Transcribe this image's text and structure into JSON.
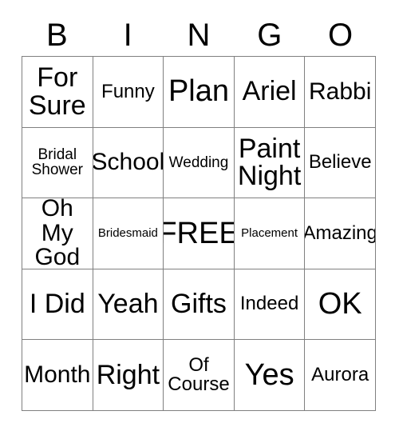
{
  "card": {
    "header_letters": [
      "B",
      "I",
      "N",
      "G",
      "O"
    ],
    "free_space_label": "FREE",
    "colors": {
      "grid_line": "#808080",
      "text": "#000000",
      "background": "#ffffff"
    },
    "rows": [
      [
        {
          "label": "For\nSure",
          "size": "xl"
        },
        {
          "label": "Funny",
          "size": "m"
        },
        {
          "label": "Plan",
          "size": "xxl"
        },
        {
          "label": "Ariel",
          "size": "xl"
        },
        {
          "label": "Rabbi",
          "size": "l"
        }
      ],
      [
        {
          "label": "Bridal\nShower",
          "size": "s"
        },
        {
          "label": "School",
          "size": "l"
        },
        {
          "label": "Wedding",
          "size": "s"
        },
        {
          "label": "Paint\nNight",
          "size": "xl"
        },
        {
          "label": "Believe",
          "size": "m"
        }
      ],
      [
        {
          "label": "Oh My\nGod",
          "size": "l"
        },
        {
          "label": "Bridesmaid",
          "size": "xs"
        },
        {
          "label": "FREE",
          "size": "xxl"
        },
        {
          "label": "Placement",
          "size": "xs"
        },
        {
          "label": "Amazing",
          "size": "m"
        }
      ],
      [
        {
          "label": "I Did",
          "size": "xl"
        },
        {
          "label": "Yeah",
          "size": "xl"
        },
        {
          "label": "Gifts",
          "size": "xl"
        },
        {
          "label": "Indeed",
          "size": "m"
        },
        {
          "label": "OK",
          "size": "xxl"
        }
      ],
      [
        {
          "label": "Month",
          "size": "l"
        },
        {
          "label": "Right",
          "size": "xl"
        },
        {
          "label": "Of\nCourse",
          "size": "m"
        },
        {
          "label": "Yes",
          "size": "xxl"
        },
        {
          "label": "Aurora",
          "size": "m"
        }
      ]
    ]
  }
}
